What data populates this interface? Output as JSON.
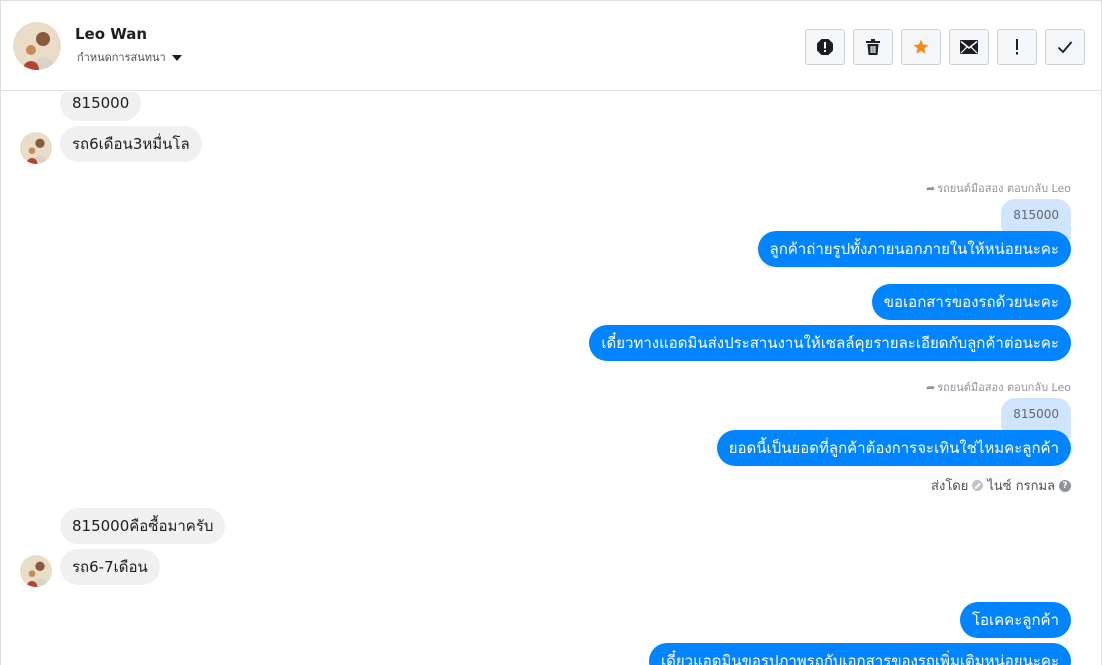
{
  "header": {
    "user_name": "Leo Wan",
    "assign_label": "กำหนดการสนทนา"
  },
  "toolbar": {
    "buttons": [
      {
        "name": "report-icon"
      },
      {
        "name": "trash-icon"
      },
      {
        "name": "star-icon",
        "color": "#f28b1d"
      },
      {
        "name": "envelope-icon"
      },
      {
        "name": "exclamation-icon"
      },
      {
        "name": "checkmark-icon"
      }
    ]
  },
  "messages": {
    "in_1": "815000",
    "in_2": "รถ6เดือน3หมื่นโล",
    "reply_note_1": "รถยนต์มือสอง ตอบกลับ Leo",
    "quote_1": "815000",
    "out_1": "ลูกค้าถ่ายรูปทั้งภายนอกภายในให้หน่อยนะคะ",
    "out_2": "ขอเอกสารของรถด้วยนะคะ",
    "out_3": "เดี๋ยวทางแอดมินส่งประสานงานให้เซลล์คุยรายละเอียดกับลูกค้าต่อนะคะ",
    "reply_note_2": "รถยนต์มือสอง ตอบกลับ Leo",
    "quote_2": "815000",
    "out_4": "ยอดนี้เป็นยอดที่ลูกค้าต้องการจะเทินใช่ไหมคะลูกค้า",
    "sent_by_label": "ส่งโดย",
    "sent_by_name": "ไนซ์ กรกมล",
    "in_3": "815000คือซื้อมาครับ",
    "in_4": "รถ6-7เดือน",
    "out_5": "โอเคคะลูกค้า",
    "out_6": "เดี๋ยวแอดมินขอรูปภาพรถกับเอกสารของรถเพิ่มเติมหน่อยนะคะ"
  },
  "colors": {
    "outgoing_bubble": "#0084ff",
    "incoming_bubble": "#f1f0f0",
    "quote_bubble": "#cfe4fd"
  }
}
